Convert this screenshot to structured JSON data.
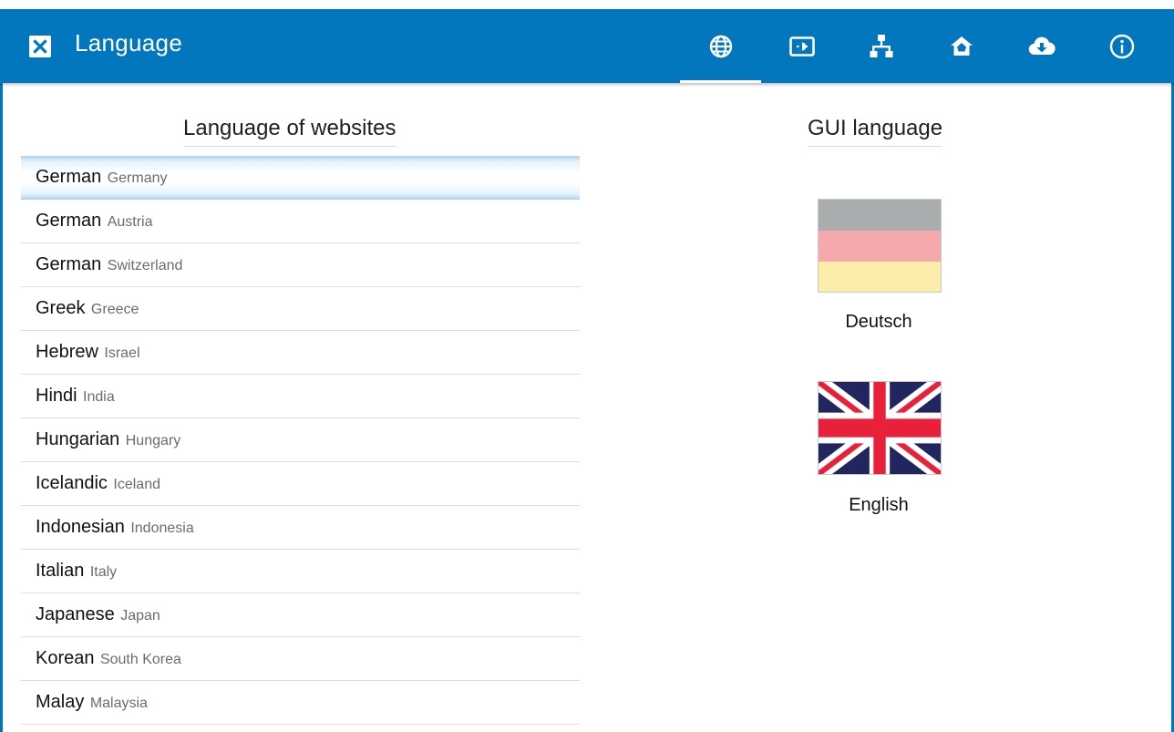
{
  "window": {
    "title": "Language"
  },
  "toolbar": {
    "icons": [
      "globe-icon",
      "display-icon",
      "network-icon",
      "home-icon",
      "cloud-download-icon",
      "info-icon"
    ]
  },
  "colors": {
    "titlebar": "#0277bd",
    "selected_row": "#a9d3ef"
  },
  "websites": {
    "title": "Language of websites",
    "items": [
      {
        "name": "German",
        "region": "Germany",
        "selected": true
      },
      {
        "name": "German",
        "region": "Austria"
      },
      {
        "name": "German",
        "region": "Switzerland"
      },
      {
        "name": "Greek",
        "region": "Greece"
      },
      {
        "name": "Hebrew",
        "region": "Israel"
      },
      {
        "name": "Hindi",
        "region": "India"
      },
      {
        "name": "Hungarian",
        "region": "Hungary"
      },
      {
        "name": "Icelandic",
        "region": "Iceland"
      },
      {
        "name": "Indonesian",
        "region": "Indonesia"
      },
      {
        "name": "Italian",
        "region": "Italy"
      },
      {
        "name": "Japanese",
        "region": "Japan"
      },
      {
        "name": "Korean",
        "region": "South Korea"
      },
      {
        "name": "Malay",
        "region": "Malaysia"
      }
    ]
  },
  "gui": {
    "title": "GUI language",
    "options": [
      {
        "label": "Deutsch",
        "flag": "germany-flag"
      },
      {
        "label": "English",
        "flag": "uk-flag"
      }
    ]
  }
}
